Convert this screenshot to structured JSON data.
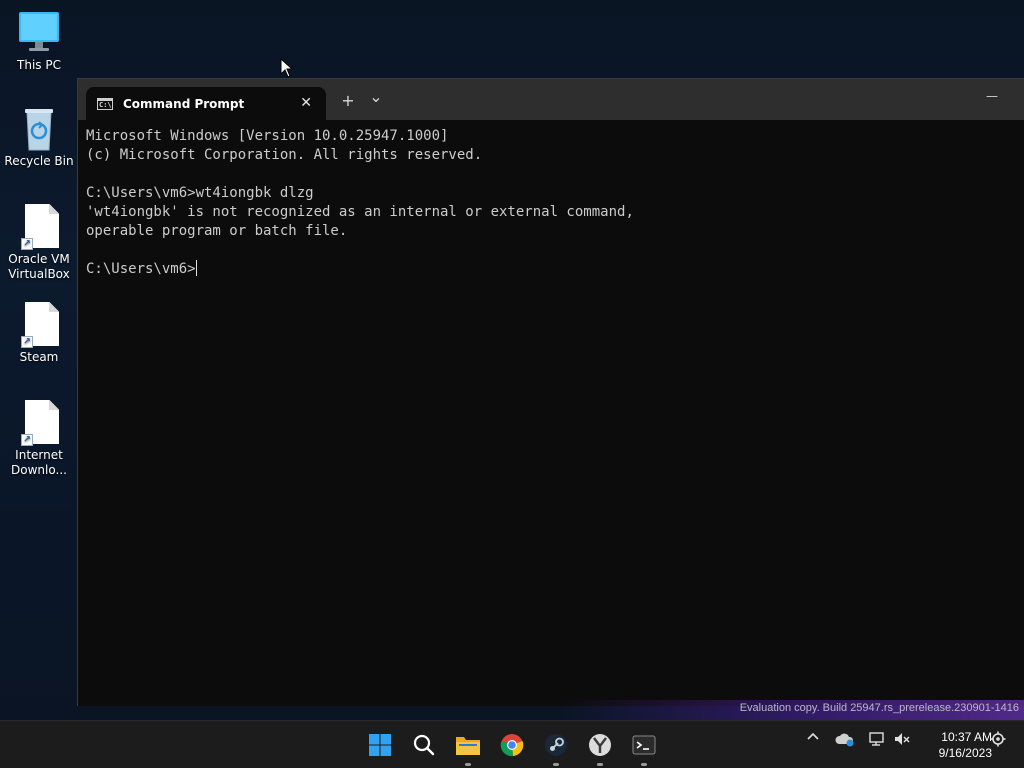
{
  "desktop": {
    "icons": [
      {
        "label": "This PC"
      },
      {
        "label": "Recycle Bin"
      },
      {
        "label": "Oracle VM VirtualBox"
      },
      {
        "label": "Steam"
      },
      {
        "label": "Internet Downlo..."
      }
    ]
  },
  "window": {
    "tab_title": "Command Prompt",
    "tab_close": "✕",
    "new_tab": "+",
    "dropdown": "⌄",
    "minimize": "—",
    "console_lines": [
      "Microsoft Windows [Version 10.0.25947.1000]",
      "(c) Microsoft Corporation. All rights reserved.",
      "",
      "C:\\Users\\vm6>wt4iongbk dlzg",
      "'wt4iongbk' is not recognized as an internal or external command,",
      "operable program or batch file.",
      "",
      "C:\\Users\\vm6>"
    ]
  },
  "watermark": "Evaluation copy. Build 25947.rs_prerelease.230901-1416",
  "taskbar": {
    "apps": [
      "start-icon",
      "search-icon",
      "file-explorer-icon",
      "chrome-icon",
      "steam-icon",
      "virtualbox-icon",
      "terminal-icon"
    ],
    "clock_time": "10:37 AM",
    "clock_date": "9/16/2023"
  },
  "colors": {
    "console_bg": "#0c0c0c",
    "console_text": "#cccccc",
    "titlebar": "#2e2e2e",
    "taskbar": "#1c1c1c",
    "accent": "#0078d4"
  }
}
